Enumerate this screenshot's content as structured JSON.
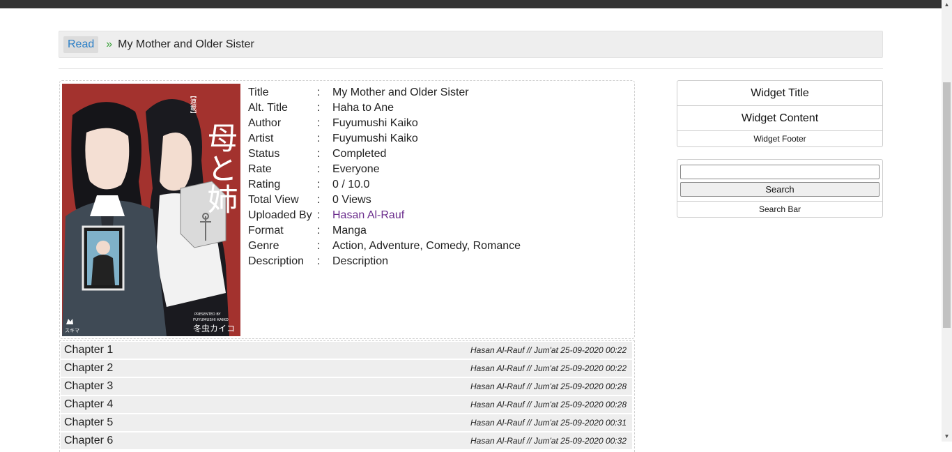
{
  "breadcrumb": {
    "link": "Read",
    "separator": "»",
    "current": "My Mother and Older Sister"
  },
  "info": {
    "colon": ":",
    "rows": [
      {
        "key": "Title",
        "value": "My Mother and Older Sister"
      },
      {
        "key": "Alt. Title",
        "value": "Haha to Ane"
      },
      {
        "key": "Author",
        "value": "Fuyumushi Kaiko"
      },
      {
        "key": "Artist",
        "value": "Fuyumushi Kaiko"
      },
      {
        "key": "Status",
        "value": "Completed"
      },
      {
        "key": "Rate",
        "value": "Everyone"
      },
      {
        "key": "Rating",
        "value": "0 / 10.0"
      },
      {
        "key": "Total View",
        "value": "0 Views"
      },
      {
        "key": "Uploaded By",
        "value": "Hasan Al-Rauf"
      },
      {
        "key": "Format",
        "value": "Manga"
      },
      {
        "key": "Genre",
        "value": "Action, Adventure, Comedy, Romance"
      },
      {
        "key": "Description",
        "value": "Description"
      }
    ]
  },
  "cover": {
    "title_jp": "母と姉",
    "tag_jp": "【連載】",
    "author_en": "FUYUMUSHI KAIKO",
    "presented": "PRESENTED BY",
    "author_jp": "冬虫カイコ",
    "publisher": "スキマ"
  },
  "chapters": [
    {
      "title": "Chapter 1",
      "meta": "Hasan Al-Rauf // Jum'at 25-09-2020 00:22"
    },
    {
      "title": "Chapter 2",
      "meta": "Hasan Al-Rauf // Jum'at 25-09-2020 00:22"
    },
    {
      "title": "Chapter 3",
      "meta": "Hasan Al-Rauf // Jum'at 25-09-2020 00:28"
    },
    {
      "title": "Chapter 4",
      "meta": "Hasan Al-Rauf // Jum'at 25-09-2020 00:28"
    },
    {
      "title": "Chapter 5",
      "meta": "Hasan Al-Rauf // Jum'at 25-09-2020 00:31"
    },
    {
      "title": "Chapter 6",
      "meta": "Hasan Al-Rauf // Jum'at 25-09-2020 00:32"
    }
  ],
  "widget": {
    "title": "Widget Title",
    "content": "Widget Content",
    "footer": "Widget Footer"
  },
  "search": {
    "value": "",
    "button": "Search",
    "footer": "Search Bar"
  },
  "colors": {
    "topbar": "#333333",
    "link": "#2b7fc7",
    "separator": "#3aa13a",
    "uploader_link": "#6a2c8c"
  }
}
